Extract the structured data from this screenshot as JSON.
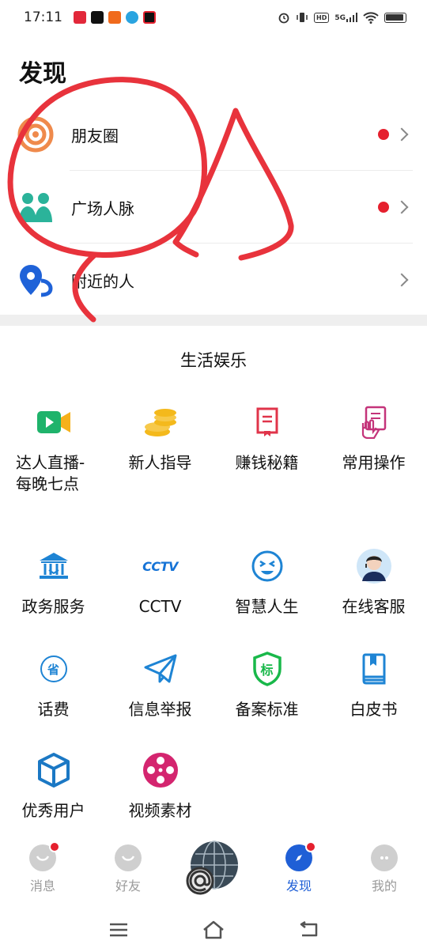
{
  "status": {
    "time": "17:11",
    "network": "5G",
    "hd": "HD"
  },
  "page": {
    "title": "发现"
  },
  "top_list": [
    {
      "label": "朋友圈",
      "has_dot": true
    },
    {
      "label": "广场人脉",
      "has_dot": true
    },
    {
      "label": "附近的人",
      "has_dot": false
    }
  ],
  "section": {
    "title": "生活娱乐"
  },
  "grid": [
    {
      "label": "达人直播-每晚七点",
      "icon": "video-live-icon"
    },
    {
      "label": "新人指导",
      "icon": "coins-icon"
    },
    {
      "label": "赚钱秘籍",
      "icon": "book-marker-icon"
    },
    {
      "label": "常用操作",
      "icon": "hand-document-icon"
    },
    {
      "label": "政务服务",
      "icon": "government-building-icon"
    },
    {
      "label": "CCTV",
      "icon": "cctv-logo-icon"
    },
    {
      "label": "智慧人生",
      "icon": "smiley-face-icon"
    },
    {
      "label": "在线客服",
      "icon": "customer-service-avatar"
    },
    {
      "label": "话费",
      "icon": "province-badge-icon"
    },
    {
      "label": "信息举报",
      "icon": "paper-plane-icon"
    },
    {
      "label": "备案标准",
      "icon": "standard-shield-icon"
    },
    {
      "label": "白皮书",
      "icon": "whitebook-icon"
    },
    {
      "label": "优秀用户",
      "icon": "cube-icon"
    },
    {
      "label": "视频素材",
      "icon": "film-reel-icon"
    }
  ],
  "grid_badges": {
    "province": "省",
    "standard": "标",
    "cctv": "CCTV"
  },
  "tabs": [
    {
      "label": "消息",
      "badge": true,
      "active": false
    },
    {
      "label": "好友",
      "badge": false,
      "active": false
    },
    {
      "label": "",
      "badge": false,
      "active": false
    },
    {
      "label": "发现",
      "badge": true,
      "active": true
    },
    {
      "label": "我的",
      "badge": false,
      "active": false
    }
  ],
  "colors": {
    "accent": "#1f5fd6",
    "badge": "#e5202e",
    "annotation": "#e8333c"
  }
}
